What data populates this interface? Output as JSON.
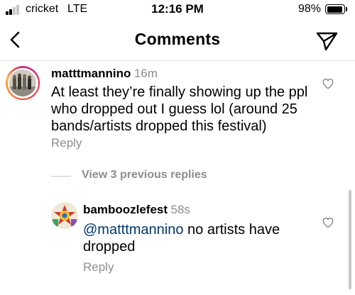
{
  "status_bar": {
    "carrier": "cricket",
    "network": "LTE",
    "time": "12:16 PM",
    "battery_percent": "98%",
    "battery_level": 0.98
  },
  "header": {
    "title": "Comments",
    "back_icon": "chevron-left-icon",
    "send_icon": "paper-plane-icon"
  },
  "comments": [
    {
      "username": "matttmannino",
      "time": "16m",
      "lines": [
        "At least they’re finally showing up the ppl",
        "who dropped out I guess lol (around 25",
        "bands/artists dropped this festival)"
      ],
      "reply_label": "Reply",
      "like_icon": "heart-outline-icon"
    }
  ],
  "view_previous_replies": "View 3 previous replies",
  "replies": [
    {
      "username": "bamboozlefest",
      "time": "58s",
      "mention": "@matttmannino",
      "text_after_mention": " no artists have",
      "line2": "dropped",
      "reply_label": "Reply",
      "like_icon": "heart-outline-icon"
    }
  ],
  "colors": {
    "secondary_text": "#8e8e8e",
    "mention": "#00376b",
    "divider": "#dbdbdb"
  }
}
